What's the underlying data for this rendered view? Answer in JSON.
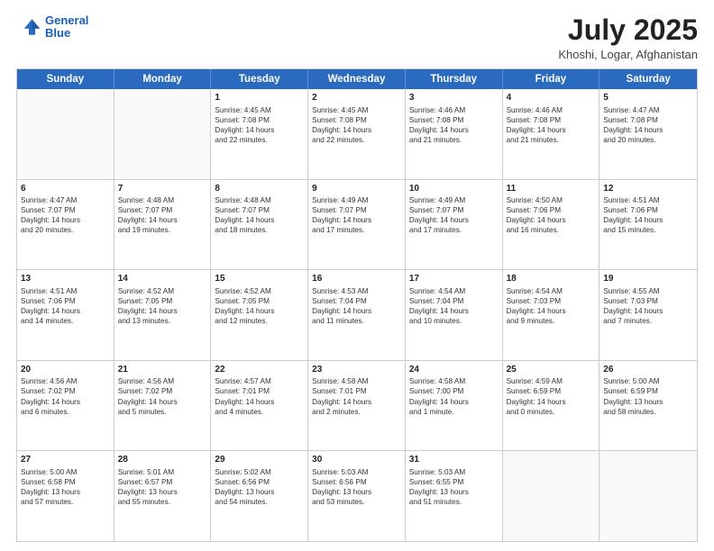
{
  "header": {
    "logo_line1": "General",
    "logo_line2": "Blue",
    "month": "July 2025",
    "location": "Khoshi, Logar, Afghanistan"
  },
  "weekdays": [
    "Sunday",
    "Monday",
    "Tuesday",
    "Wednesday",
    "Thursday",
    "Friday",
    "Saturday"
  ],
  "rows": [
    [
      {
        "day": "",
        "text": "",
        "empty": true
      },
      {
        "day": "",
        "text": "",
        "empty": true
      },
      {
        "day": "1",
        "text": "Sunrise: 4:45 AM\nSunset: 7:08 PM\nDaylight: 14 hours\nand 22 minutes."
      },
      {
        "day": "2",
        "text": "Sunrise: 4:45 AM\nSunset: 7:08 PM\nDaylight: 14 hours\nand 22 minutes."
      },
      {
        "day": "3",
        "text": "Sunrise: 4:46 AM\nSunset: 7:08 PM\nDaylight: 14 hours\nand 21 minutes."
      },
      {
        "day": "4",
        "text": "Sunrise: 4:46 AM\nSunset: 7:08 PM\nDaylight: 14 hours\nand 21 minutes."
      },
      {
        "day": "5",
        "text": "Sunrise: 4:47 AM\nSunset: 7:08 PM\nDaylight: 14 hours\nand 20 minutes."
      }
    ],
    [
      {
        "day": "6",
        "text": "Sunrise: 4:47 AM\nSunset: 7:07 PM\nDaylight: 14 hours\nand 20 minutes."
      },
      {
        "day": "7",
        "text": "Sunrise: 4:48 AM\nSunset: 7:07 PM\nDaylight: 14 hours\nand 19 minutes."
      },
      {
        "day": "8",
        "text": "Sunrise: 4:48 AM\nSunset: 7:07 PM\nDaylight: 14 hours\nand 18 minutes."
      },
      {
        "day": "9",
        "text": "Sunrise: 4:49 AM\nSunset: 7:07 PM\nDaylight: 14 hours\nand 17 minutes."
      },
      {
        "day": "10",
        "text": "Sunrise: 4:49 AM\nSunset: 7:07 PM\nDaylight: 14 hours\nand 17 minutes."
      },
      {
        "day": "11",
        "text": "Sunrise: 4:50 AM\nSunset: 7:06 PM\nDaylight: 14 hours\nand 16 minutes."
      },
      {
        "day": "12",
        "text": "Sunrise: 4:51 AM\nSunset: 7:06 PM\nDaylight: 14 hours\nand 15 minutes."
      }
    ],
    [
      {
        "day": "13",
        "text": "Sunrise: 4:51 AM\nSunset: 7:06 PM\nDaylight: 14 hours\nand 14 minutes."
      },
      {
        "day": "14",
        "text": "Sunrise: 4:52 AM\nSunset: 7:05 PM\nDaylight: 14 hours\nand 13 minutes."
      },
      {
        "day": "15",
        "text": "Sunrise: 4:52 AM\nSunset: 7:05 PM\nDaylight: 14 hours\nand 12 minutes."
      },
      {
        "day": "16",
        "text": "Sunrise: 4:53 AM\nSunset: 7:04 PM\nDaylight: 14 hours\nand 11 minutes."
      },
      {
        "day": "17",
        "text": "Sunrise: 4:54 AM\nSunset: 7:04 PM\nDaylight: 14 hours\nand 10 minutes."
      },
      {
        "day": "18",
        "text": "Sunrise: 4:54 AM\nSunset: 7:03 PM\nDaylight: 14 hours\nand 9 minutes."
      },
      {
        "day": "19",
        "text": "Sunrise: 4:55 AM\nSunset: 7:03 PM\nDaylight: 14 hours\nand 7 minutes."
      }
    ],
    [
      {
        "day": "20",
        "text": "Sunrise: 4:56 AM\nSunset: 7:02 PM\nDaylight: 14 hours\nand 6 minutes."
      },
      {
        "day": "21",
        "text": "Sunrise: 4:56 AM\nSunset: 7:02 PM\nDaylight: 14 hours\nand 5 minutes."
      },
      {
        "day": "22",
        "text": "Sunrise: 4:57 AM\nSunset: 7:01 PM\nDaylight: 14 hours\nand 4 minutes."
      },
      {
        "day": "23",
        "text": "Sunrise: 4:58 AM\nSunset: 7:01 PM\nDaylight: 14 hours\nand 2 minutes."
      },
      {
        "day": "24",
        "text": "Sunrise: 4:58 AM\nSunset: 7:00 PM\nDaylight: 14 hours\nand 1 minute."
      },
      {
        "day": "25",
        "text": "Sunrise: 4:59 AM\nSunset: 6:59 PM\nDaylight: 14 hours\nand 0 minutes."
      },
      {
        "day": "26",
        "text": "Sunrise: 5:00 AM\nSunset: 6:59 PM\nDaylight: 13 hours\nand 58 minutes."
      }
    ],
    [
      {
        "day": "27",
        "text": "Sunrise: 5:00 AM\nSunset: 6:58 PM\nDaylight: 13 hours\nand 57 minutes."
      },
      {
        "day": "28",
        "text": "Sunrise: 5:01 AM\nSunset: 6:57 PM\nDaylight: 13 hours\nand 55 minutes."
      },
      {
        "day": "29",
        "text": "Sunrise: 5:02 AM\nSunset: 6:56 PM\nDaylight: 13 hours\nand 54 minutes."
      },
      {
        "day": "30",
        "text": "Sunrise: 5:03 AM\nSunset: 6:56 PM\nDaylight: 13 hours\nand 53 minutes."
      },
      {
        "day": "31",
        "text": "Sunrise: 5:03 AM\nSunset: 6:55 PM\nDaylight: 13 hours\nand 51 minutes."
      },
      {
        "day": "",
        "text": "",
        "empty": true
      },
      {
        "day": "",
        "text": "",
        "empty": true
      }
    ]
  ]
}
